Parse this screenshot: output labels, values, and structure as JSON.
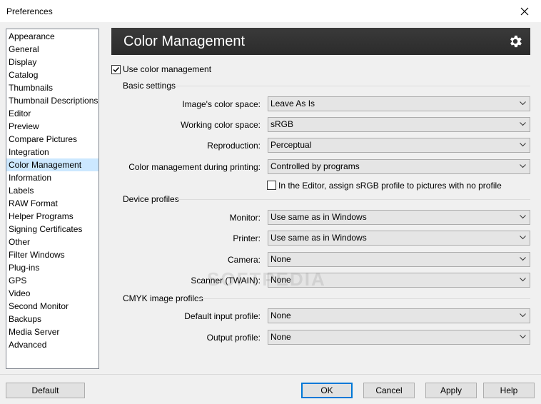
{
  "window": {
    "title": "Preferences"
  },
  "sidebar": {
    "items": [
      {
        "label": "Appearance"
      },
      {
        "label": "General"
      },
      {
        "label": "Display"
      },
      {
        "label": "Catalog"
      },
      {
        "label": "Thumbnails"
      },
      {
        "label": "Thumbnail Descriptions"
      },
      {
        "label": "Editor"
      },
      {
        "label": "Preview"
      },
      {
        "label": "Compare Pictures"
      },
      {
        "label": "Integration"
      },
      {
        "label": "Color Management",
        "selected": true
      },
      {
        "label": "Information"
      },
      {
        "label": "Labels"
      },
      {
        "label": "RAW Format"
      },
      {
        "label": "Helper Programs"
      },
      {
        "label": "Signing Certificates"
      },
      {
        "label": "Other"
      },
      {
        "label": "Filter Windows"
      },
      {
        "label": "Plug-ins"
      },
      {
        "label": "GPS"
      },
      {
        "label": "Video"
      },
      {
        "label": "Second Monitor"
      },
      {
        "label": "Backups"
      },
      {
        "label": "Media Server"
      },
      {
        "label": "Advanced"
      }
    ]
  },
  "header": {
    "title": "Color Management",
    "icon": "gear-icon"
  },
  "use_cm": {
    "label": "Use color management",
    "checked": true
  },
  "basic": {
    "title": "Basic settings",
    "image_cs": {
      "label": "Image's color space:",
      "value": "Leave As Is"
    },
    "working_cs": {
      "label": "Working color space:",
      "value": "sRGB"
    },
    "reproduction": {
      "label": "Reproduction:",
      "value": "Perceptual"
    },
    "printing": {
      "label": "Color management during printing:",
      "value": "Controlled by programs"
    },
    "assign_srgb": {
      "label": "In the Editor, assign sRGB profile to pictures with no profile",
      "checked": false
    }
  },
  "device": {
    "title": "Device profiles",
    "monitor": {
      "label": "Monitor:",
      "value": "Use same as in Windows"
    },
    "printer": {
      "label": "Printer:",
      "value": "Use same as in Windows"
    },
    "camera": {
      "label": "Camera:",
      "value": "None"
    },
    "scanner": {
      "label": "Scanner (TWAIN):",
      "value": "None"
    }
  },
  "cmyk": {
    "title": "CMYK image profiles",
    "input": {
      "label": "Default input profile:",
      "value": "None"
    },
    "output": {
      "label": "Output profile:",
      "value": "None"
    }
  },
  "buttons": {
    "default": "Default",
    "ok": "OK",
    "cancel": "Cancel",
    "apply": "Apply",
    "help": "Help"
  },
  "watermark": "SOFTPEDIA",
  "colors": {
    "header_bg": "#333333",
    "selected_bg": "#cce8ff",
    "ok_border": "#0078d7"
  }
}
